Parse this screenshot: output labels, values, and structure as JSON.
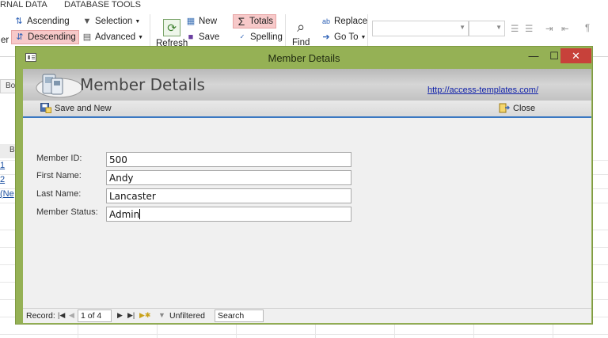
{
  "ribbon": {
    "tabs": [
      "RNAL DATA",
      "DATABASE TOOLS"
    ],
    "ascending": "Ascending",
    "descending": "Descending",
    "selection": "Selection",
    "advanced": "Advanced",
    "refresh": "Refresh",
    "new": "New",
    "save": "Save",
    "totals": "Totals",
    "spelling": "Spelling",
    "find": "Find",
    "replace": "Replace",
    "goto": "Go To",
    "left_cut": "er"
  },
  "background": {
    "tab_label": "Bo",
    "head_label": "B",
    "cells": [
      "1",
      "2",
      "(Ne"
    ]
  },
  "window": {
    "title": "Member Details",
    "min_glyph": "—",
    "max_glyph": "☐",
    "close_glyph": "✕"
  },
  "form": {
    "header_title": "Member Details",
    "link": "http://access-templates.com/",
    "toolbar": {
      "save_new": "Save and New",
      "close": "Close"
    },
    "fields": [
      {
        "label": "Member ID:",
        "value": "500"
      },
      {
        "label": "First Name:",
        "value": "Andy"
      },
      {
        "label": "Last Name:",
        "value": "Lancaster"
      },
      {
        "label": "Member Status:",
        "value": "Admin"
      }
    ]
  },
  "nav": {
    "record_label": "Record:",
    "position": "1 of 4",
    "filter": "Unfiltered",
    "search": "Search"
  },
  "colors": {
    "window_frame": "#95b155",
    "close_button": "#c7413a",
    "totals_highlight": "#f7c9c9",
    "link": "#1122aa",
    "toolbar_underline": "#3a78c2"
  }
}
